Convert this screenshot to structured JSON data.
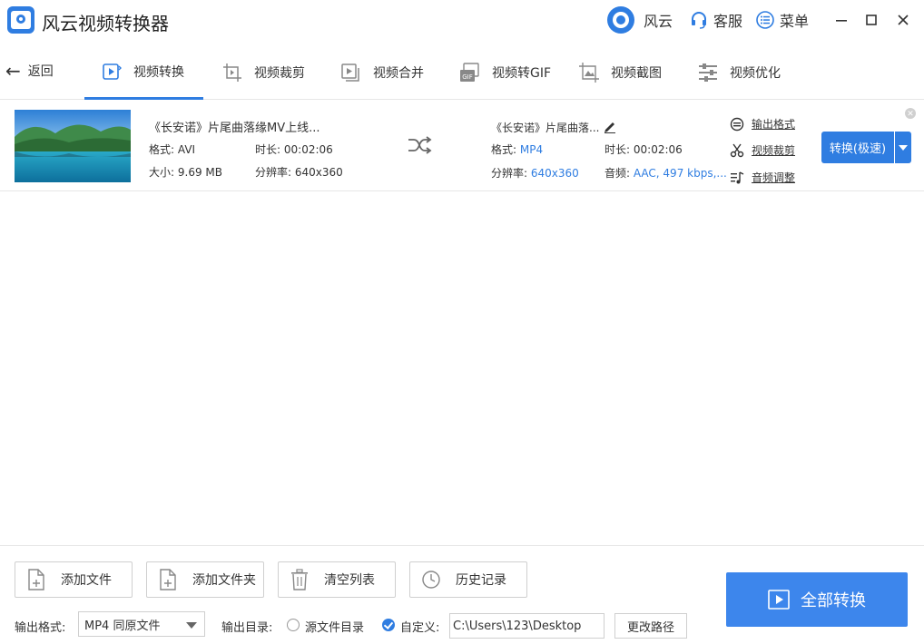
{
  "app": {
    "title": "风云视频转换器"
  },
  "titlebar": {
    "fengyun_label": "风云",
    "service_label": "客服",
    "menu_label": "菜单",
    "icons": [
      "fengyun-logo-icon",
      "headset-icon",
      "list-menu-icon",
      "minimize-icon",
      "maximize-icon",
      "close-icon"
    ]
  },
  "nav": {
    "back_label": "返回",
    "tabs": [
      {
        "label": "视频转换",
        "icon": "video-convert-icon",
        "active": true
      },
      {
        "label": "视频裁剪",
        "icon": "video-crop-icon",
        "active": false
      },
      {
        "label": "视频合并",
        "icon": "video-merge-icon",
        "active": false
      },
      {
        "label": "视频转GIF",
        "icon": "gif-icon",
        "active": false
      },
      {
        "label": "视频截图",
        "icon": "screenshot-icon",
        "active": false
      },
      {
        "label": "视频优化",
        "icon": "sliders-icon",
        "active": false
      }
    ]
  },
  "file": {
    "source": {
      "name": "《长安诺》片尾曲落缘MV上线...",
      "format_label": "格式:",
      "format": "AVI",
      "duration_label": "时长:",
      "duration": "00:02:06",
      "size_label": "大小:",
      "size": "9.69 MB",
      "resolution_label": "分辨率:",
      "resolution": "640x360"
    },
    "output": {
      "name": "《长安诺》片尾曲落...",
      "format_label": "格式:",
      "format": "MP4",
      "duration_label": "时长:",
      "duration": "00:02:06",
      "resolution_label": "分辨率:",
      "resolution": "640x360",
      "audio_label": "音频:",
      "audio": "AAC, 497 kbps,..."
    },
    "actions": {
      "output_format": "输出格式",
      "video_crop": "视频裁剪",
      "audio_adjust": "音频调整"
    },
    "convert_button": "转换(极速)"
  },
  "bottom": {
    "buttons": {
      "add_file": "添加文件",
      "add_folder": "添加文件夹",
      "clear_list": "清空列表",
      "history": "历史记录"
    },
    "output_format_label": "输出格式:",
    "output_format_value": "MP4 同原文件",
    "output_dir_label": "输出目录:",
    "source_dir_option": "源文件目录",
    "custom_option": "自定义:",
    "custom_selected": true,
    "path_value": "C:\\Users\\123\\Desktop",
    "change_path": "更改路径",
    "convert_all": "全部转换"
  },
  "colors": {
    "accent": "#2f7de1",
    "primary_button": "#3d86ec"
  }
}
